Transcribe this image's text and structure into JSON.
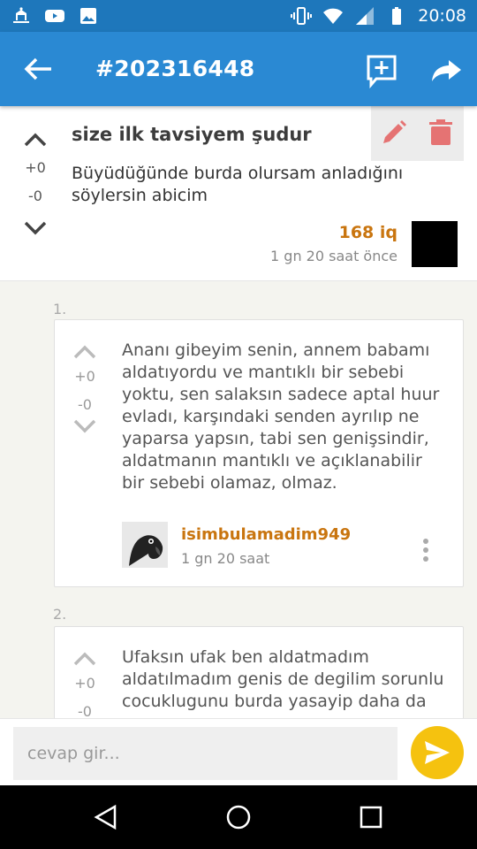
{
  "status_bar": {
    "time": "20:08",
    "icons": [
      "app-icon",
      "youtube-icon",
      "image-icon",
      "vibrate-icon",
      "wifi-icon",
      "signal-icon",
      "battery-icon"
    ]
  },
  "app_bar": {
    "title": "#202316448",
    "back_icon": "arrow-back-icon",
    "actions": [
      "add-comment-icon",
      "share-icon"
    ]
  },
  "entry": {
    "topic": "size ilk tavsiyem şudur",
    "body": "Büyüdüğünde burda olursam anladığını söylersin abicim",
    "up_count": "+0",
    "down_count": "-0",
    "author": "168 iq",
    "time": "1 gn 20 saat  önce",
    "actions": [
      "edit-icon",
      "delete-icon"
    ]
  },
  "replies": [
    {
      "number": "1.",
      "text": "Ananı gibeyim senin, annem babamı aldatıyordu ve mantıklı bir sebebi yoktu, sen salaksın sadece aptal huur evladı, karşındaki senden ayrılıp ne yaparsa yapsın, tabi sen genişsindir, aldatmanın mantıklı ve açıklanabilir bir sebebi olamaz, olmaz.",
      "up_count": "+0",
      "down_count": "-0",
      "username": "isimbulamadim949",
      "time": "1 gn 20 saat"
    },
    {
      "number": "2.",
      "text": "Ufaksın ufak ben aldatmadım aldatılmadım genis de degilim sorunlu cocuklugunu burda yasayip daha da",
      "up_count": "+0",
      "down_count": "-0"
    }
  ],
  "composer": {
    "placeholder": "cevap gir...",
    "send_icon": "send-icon"
  },
  "colors": {
    "status_bar": "#1e77bb",
    "app_bar": "#2a89d3",
    "author": "#c9750f",
    "send_button": "#f5c20f",
    "delete": "#e57373"
  }
}
